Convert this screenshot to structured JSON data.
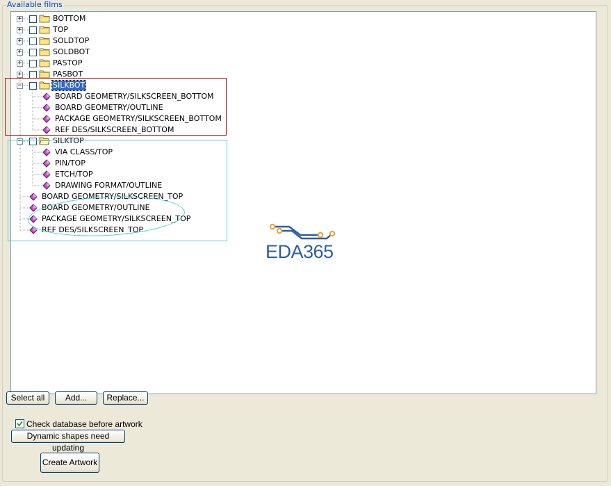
{
  "group_title": "Available films",
  "films": [
    {
      "label": "BOTTOM",
      "expanded": false
    },
    {
      "label": "TOP",
      "expanded": false
    },
    {
      "label": "SOLDTOP",
      "expanded": false
    },
    {
      "label": "SOLDBOT",
      "expanded": false
    },
    {
      "label": "PASTOP",
      "expanded": false
    },
    {
      "label": "PASBOT",
      "expanded": false
    },
    {
      "label": "SILKBOT",
      "expanded": true,
      "selected": true,
      "layers": [
        "BOARD GEOMETRY/SILKSCREEN_BOTTOM",
        "BOARD GEOMETRY/OUTLINE",
        "PACKAGE GEOMETRY/SILKSCREEN_BOTTOM",
        "REF DES/SILKSCREEN_BOTTOM"
      ]
    },
    {
      "label": "SILKTOP",
      "expanded": true,
      "layers": [
        "VIA CLASS/TOP",
        "PIN/TOP",
        "ETCH/TOP",
        "DRAWING FORMAT/OUTLINE"
      ]
    }
  ],
  "loose_layers": [
    "BOARD GEOMETRY/SILKSCREEN_TOP",
    "BOARD GEOMETRY/OUTLINE",
    "PACKAGE GEOMETRY/SILKSCREEN_TOP",
    "REF DES/SILKSCREEN_TOP"
  ],
  "watermark": {
    "text": "EDA365",
    "color": "#2b5ea5",
    "accent": "#e8a23a"
  },
  "buttons": {
    "select_all": "Select all",
    "add": "Add...",
    "replace": "Replace...",
    "dynamic_shapes": "Dynamic shapes need updating",
    "create_artwork": "Create Artwork"
  },
  "check_database": {
    "label": "Check database before artwork",
    "checked": true
  },
  "colors": {
    "selection": "#316ac5",
    "annotation_red": "#b01818",
    "annotation_cyan": "#54cfdc"
  }
}
